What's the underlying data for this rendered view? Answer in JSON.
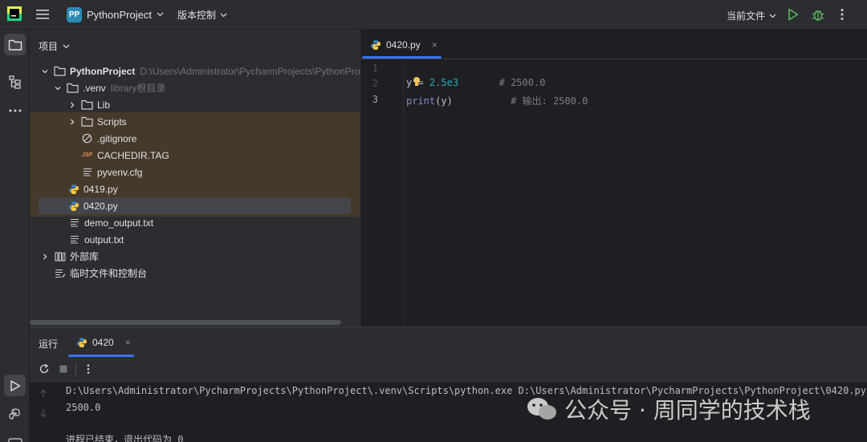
{
  "titlebar": {
    "project_badge": "PP",
    "project_name": "PythonProject",
    "vcs_label": "版本控制",
    "run_config": "当前文件"
  },
  "project_panel": {
    "header": "项目",
    "tree": [
      {
        "label": "PythonProject",
        "hint": "D:\\Users\\Administrator\\PycharmProjects\\PythonProje",
        "icon": "folder-icon",
        "level": 0,
        "expanded": true
      },
      {
        "label": ".venv",
        "hint": "library根目录",
        "icon": "folder-icon",
        "level": 1,
        "expanded": true
      },
      {
        "label": "Lib",
        "hint": "",
        "icon": "folder-icon",
        "level": 2,
        "expanded": false
      },
      {
        "label": "Scripts",
        "hint": "",
        "icon": "folder-icon",
        "level": 2,
        "expanded": false
      },
      {
        "label": ".gitignore",
        "hint": "",
        "icon": "ignore-file-icon",
        "level": 2
      },
      {
        "label": "CACHEDIR.TAG",
        "hint": "",
        "icon": "jsp-file-icon",
        "level": 2
      },
      {
        "label": "pyvenv.cfg",
        "hint": "",
        "icon": "text-file-icon",
        "level": 2
      },
      {
        "label": "0419.py",
        "hint": "",
        "icon": "python-file-icon",
        "level": 1
      },
      {
        "label": "0420.py",
        "hint": "",
        "icon": "python-file-icon",
        "level": 1,
        "selected": true
      },
      {
        "label": "demo_output.txt",
        "hint": "",
        "icon": "text-file-icon",
        "level": 1
      },
      {
        "label": "output.txt",
        "hint": "",
        "icon": "text-file-icon",
        "level": 1
      },
      {
        "label": "外部库",
        "hint": "",
        "icon": "library-icon",
        "level": 0,
        "expanded": false
      },
      {
        "label": "临时文件和控制台",
        "hint": "",
        "icon": "scratch-icon",
        "level": 0
      }
    ]
  },
  "editor": {
    "tab_label": "0420.py",
    "tab_close": "×",
    "lines": [
      {
        "num": "1"
      },
      {
        "num": "2",
        "var": "y",
        "op": " = ",
        "value": "2.5e3",
        "comment": "# 2500.0"
      },
      {
        "num": "3",
        "fn": "print",
        "args": "(y)",
        "comment": "# 输出: 2500.0"
      }
    ]
  },
  "run_panel": {
    "title": "运行",
    "tab_label": "0420",
    "tab_close": "×",
    "console": [
      "D:\\Users\\Administrator\\PycharmProjects\\PythonProject\\.venv\\Scripts\\python.exe D:\\Users\\Administrator\\PycharmProjects\\PythonProject\\0420.py",
      "2500.0",
      "",
      "进程已结束，退出代码为 0"
    ]
  },
  "watermark": {
    "text": "公众号 · 周同学的技术栈"
  },
  "colors": {
    "accent": "#3574f0",
    "panel_bg": "#2b2d30",
    "editor_bg": "#1e1f22",
    "venv_highlight": "#45392a",
    "number": "#2aacb8",
    "comment": "#7a7e85"
  }
}
